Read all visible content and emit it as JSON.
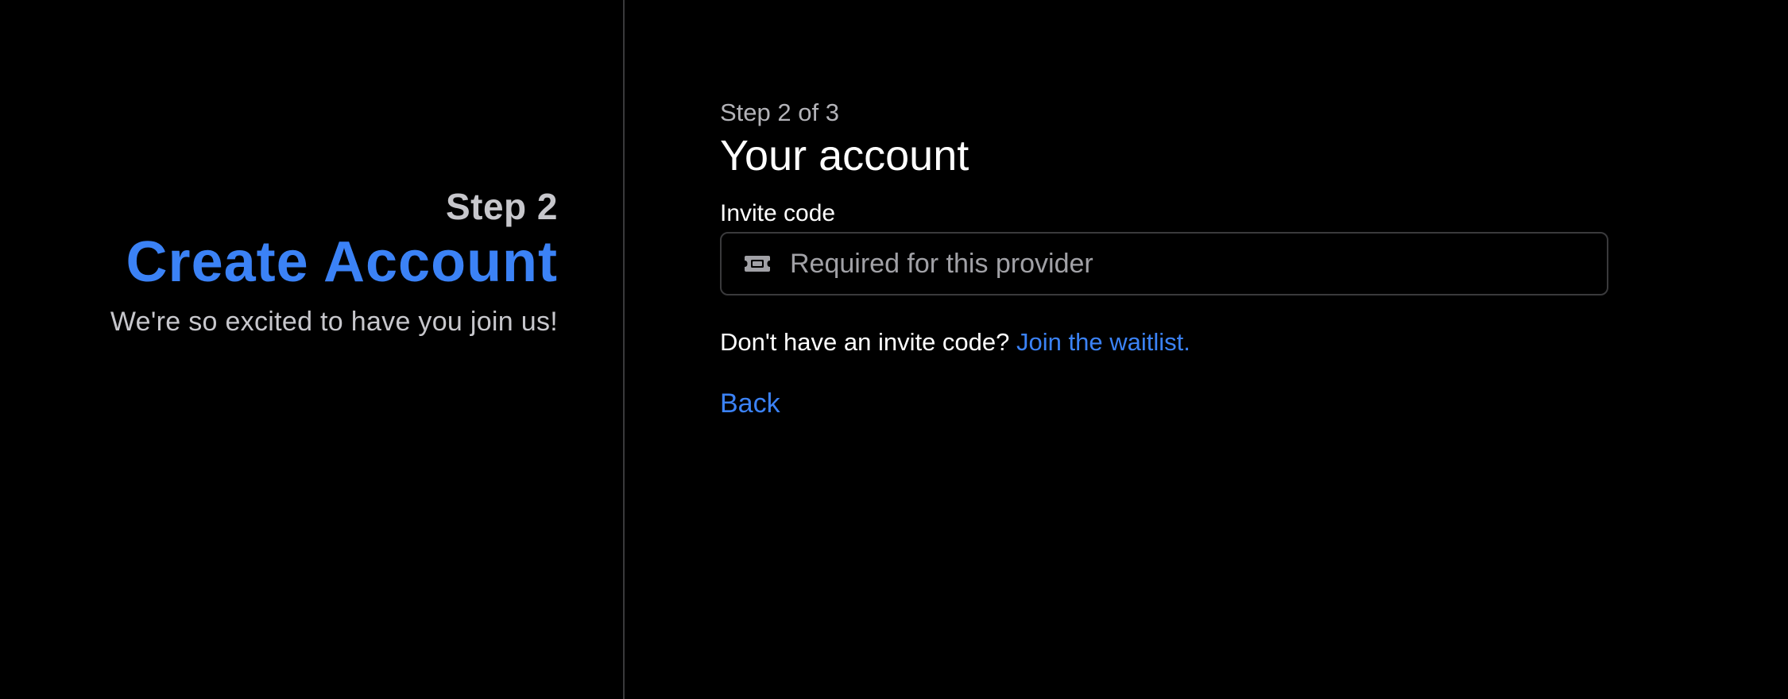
{
  "left": {
    "step_label": "Step 2",
    "title": "Create Account",
    "tagline": "We're so excited to have you join us!"
  },
  "form": {
    "step_count": "Step 2 of 3",
    "section_title": "Your account",
    "invite_label": "Invite code",
    "invite_value": "",
    "invite_placeholder": "Required for this provider",
    "invite_icon": "ticket-icon",
    "waitlist_prompt": "Don't have an invite code?",
    "waitlist_link": "Join the waitlist.",
    "back_label": "Back"
  },
  "colors": {
    "accent": "#3b82f6",
    "background": "#000000",
    "muted_text": "#c7c7cc",
    "border": "#3a3a3c"
  }
}
